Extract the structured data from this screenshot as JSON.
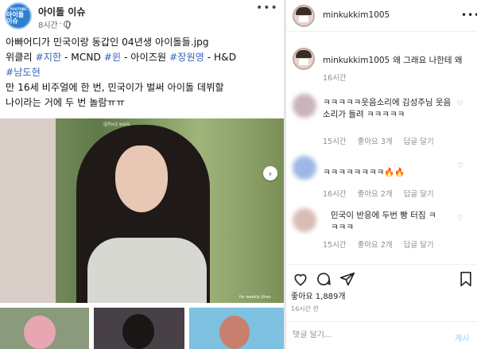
{
  "facebook": {
    "page_name": "아이돌 이슈",
    "avatar_small": "YOUTUBE",
    "avatar_text": "아이돌 이슈",
    "time": "8시간",
    "more": "•••",
    "post_lines": {
      "l1": "아빠어디가 민국이랑 동갑인 04년생 아이돌들.jpg",
      "l2a": "위클리 ",
      "tag1": "#지한",
      "l2b": " - MCND ",
      "tag2": "#윈",
      "l2c": " - 아이즈원 ",
      "tag3": "#장원영",
      "l2d": " - H&D",
      "tag4": "#남도현",
      "l4": "만 16세 비주얼에 한 번, 민국이가 벌써 아이돌 데뷔할",
      "l5": "나이라는 거에 두 번 놀람ㅠㅠ"
    },
    "image_sticker": "@fout.weis",
    "image_caption": "for weekly jihan"
  },
  "instagram": {
    "username": "minkukkim1005",
    "more": "•••",
    "caption_text": "왜 그래요 나한테 왜",
    "caption_time": "16시간",
    "comments": [
      {
        "text": "ㅋㅋㅋㅋㅋ웃음소리에 김성주님 웃음소리가 들려 ㅋㅋㅋㅋㅋ",
        "time": "15시간",
        "likes": "좋아요 3개",
        "reply": "답글 달기"
      },
      {
        "text": "ㅋㅋㅋㅋㅋㅋㅋㅋ🔥🔥",
        "time": "16시간",
        "likes": "좋아요 2개",
        "reply": "답글 달기"
      },
      {
        "text": "민국이 반응에 두번 빵 터짐 ㅋㅋㅋㅋ",
        "time": "15시간",
        "likes": "좋아요 2개",
        "reply": "답글 달기"
      }
    ],
    "likes_count": "좋아요 1,889개",
    "date": "16시간 전",
    "comment_placeholder": "댓글 달기...",
    "post_button": "게시"
  }
}
